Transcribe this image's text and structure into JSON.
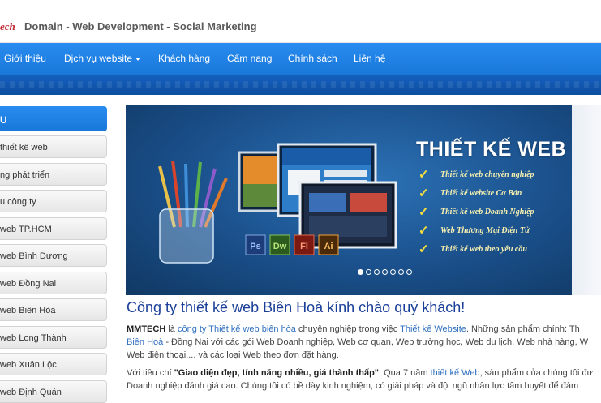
{
  "header": {
    "logo_fragment": "ech",
    "tagline": "Domain - Web Development - Social Marketing"
  },
  "nav": {
    "items": [
      "Giới thiệu",
      "Dịch vụ website",
      "Khách hàng",
      "Cẩm nang",
      "Chính sách",
      "Liên hệ"
    ]
  },
  "sidebar": {
    "heading": "U",
    "items": [
      "thiết kế web",
      "ng phát triển",
      "u công ty",
      "web TP.HCM",
      "web Bình Dương",
      "web Đồng Nai",
      "web Biên Hòa",
      "web Long Thành",
      "web Xuân Lộc",
      "web Định Quán"
    ]
  },
  "banner": {
    "title": "THIẾT KẾ WEB",
    "features": [
      "Thiết kế web chuyên nghiệp",
      "Thiết kế website Cơ Bản",
      "Thiết kế web Doanh Nghiệp",
      "Web Thương Mại Điện Tử",
      "Thiết kế web theo yêu cầu"
    ],
    "app_icons": [
      "Ps",
      "Dw",
      "Fl",
      "Ai"
    ],
    "slide_count": 7,
    "active_slide": 1
  },
  "content": {
    "heading": "Công ty thiết kế web Biên Hoà kính chào quý khách!",
    "p1": {
      "brand": "MMTECH",
      "t1": " là ",
      "l1": "công ty Thiết kế web biên hòa",
      "t2": " chuyên nghiệp trong việc ",
      "l2": "Thiết kế Website",
      "t3": ". Những sản phẩm chính: Th",
      "l3": "Biên Hoà",
      "t4": " - Đồng Nai với các gói Web Doanh nghiệp, Web cơ quan, Web trường học, Web du lịch, Web nhà hàng, W",
      "t5": "Web điện thoại,... và các loại Web theo đơn đặt hàng."
    },
    "p2": {
      "t1": "Với tiêu chí ",
      "quote": "\"Giao diện đẹp, tính năng nhiều, giá thành thấp\"",
      "t2": ". Qua 7 năm ",
      "l1": "thiết kế Web",
      "t3": ", sản phẩm của chúng tôi đư",
      "t4": "Doanh nghiệp đánh giá cao. Chúng tôi có bề dày kinh nghiệm, có giải pháp và đội ngũ nhân lực tâm huyết để đảm"
    }
  },
  "colors": {
    "nav_blue": "#1e80e6",
    "heading_blue": "#1b3f99",
    "link_blue": "#2f6fc1",
    "logo_red": "#c0262c"
  }
}
